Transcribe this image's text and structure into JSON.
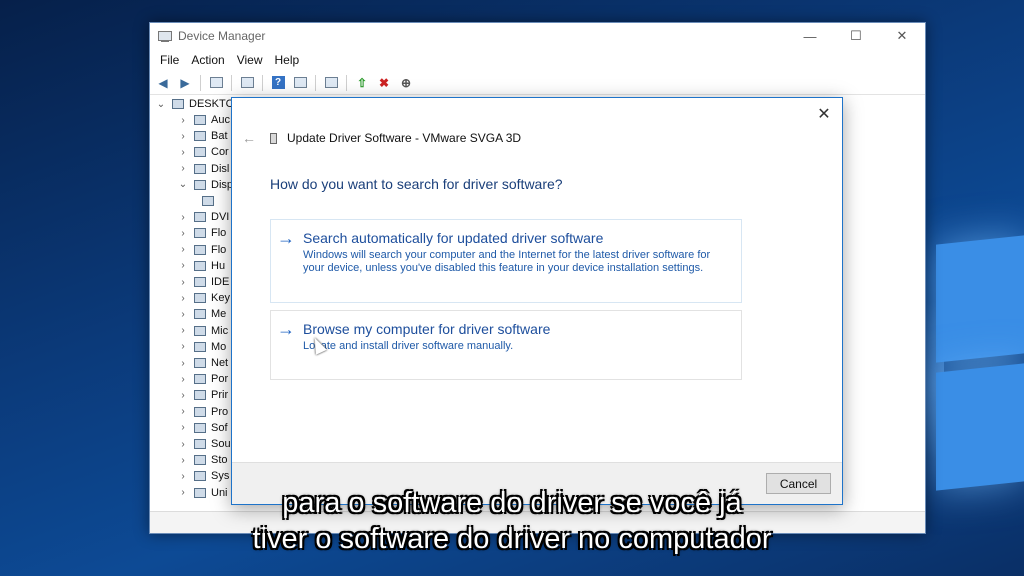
{
  "device_manager": {
    "title": "Device Manager",
    "menu": [
      "File",
      "Action",
      "View",
      "Help"
    ],
    "caption_buttons": {
      "minimize": "—",
      "maximize": "☐",
      "close": "✕"
    },
    "tree": {
      "root": "DESKTC",
      "items": [
        {
          "label": "Auc",
          "expanded": false
        },
        {
          "label": "Bat",
          "expanded": false
        },
        {
          "label": "Cor",
          "expanded": false
        },
        {
          "label": "Disl",
          "expanded": false
        },
        {
          "label": "Disp",
          "expanded": true
        },
        {
          "label": "",
          "child": true
        },
        {
          "label": "DVI",
          "expanded": false
        },
        {
          "label": "Flo",
          "expanded": false
        },
        {
          "label": "Flo",
          "expanded": false
        },
        {
          "label": "Hu",
          "expanded": false
        },
        {
          "label": "IDE",
          "expanded": false
        },
        {
          "label": "Key",
          "expanded": false
        },
        {
          "label": "Me",
          "expanded": false
        },
        {
          "label": "Mic",
          "expanded": false
        },
        {
          "label": "Mo",
          "expanded": false
        },
        {
          "label": "Net",
          "expanded": false
        },
        {
          "label": "Por",
          "expanded": false
        },
        {
          "label": "Prir",
          "expanded": false
        },
        {
          "label": "Pro",
          "expanded": false
        },
        {
          "label": "Sof",
          "expanded": false
        },
        {
          "label": "Sou",
          "expanded": false
        },
        {
          "label": "Sto",
          "expanded": false
        },
        {
          "label": "Sys",
          "expanded": false
        },
        {
          "label": "Uni",
          "expanded": false
        }
      ]
    }
  },
  "dialog": {
    "title": "Update Driver Software - VMware SVGA 3D",
    "close": "✕",
    "question": "How do you want to search for driver software?",
    "options": [
      {
        "title": "Search automatically for updated driver software",
        "description": "Windows will search your computer and the Internet for the latest driver software for your device, unless you've disabled this feature in your device installation settings."
      },
      {
        "title": "Browse my computer for driver software",
        "description": "Locate and install driver software manually."
      }
    ],
    "cancel": "Cancel"
  },
  "subtitles": {
    "line1": "para o software do driver se você já",
    "line2": "tiver o software do driver no computador"
  }
}
